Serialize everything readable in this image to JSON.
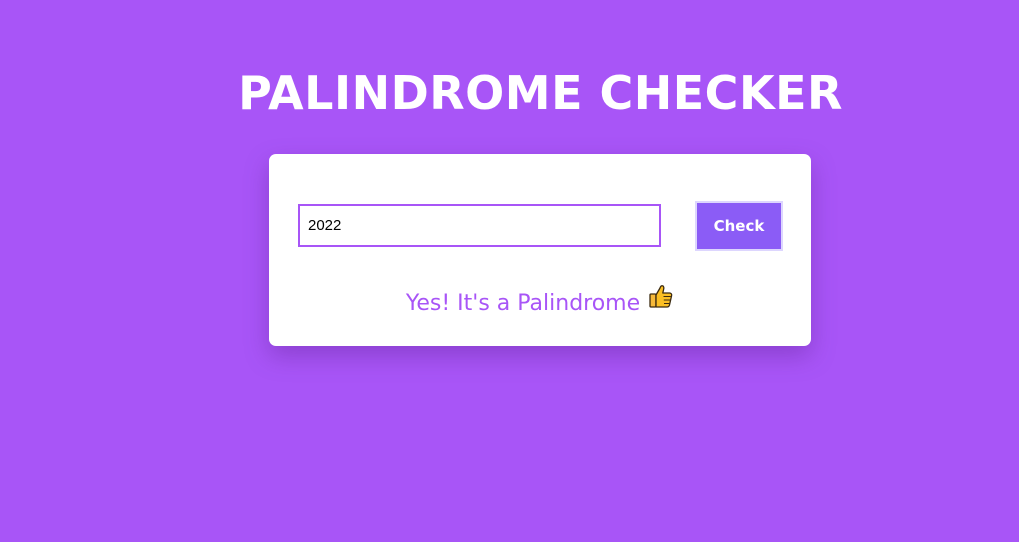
{
  "app": {
    "title": "PALINDROME CHECKER"
  },
  "form": {
    "input_value": "2022",
    "check_label": "Check"
  },
  "result": {
    "text": "Yes! It's a Palindrome",
    "icon": "thumbs-up-icon"
  },
  "colors": {
    "background": "#a855f7",
    "accent": "#a855f7",
    "button": "#8b5cf6",
    "card": "#ffffff"
  }
}
